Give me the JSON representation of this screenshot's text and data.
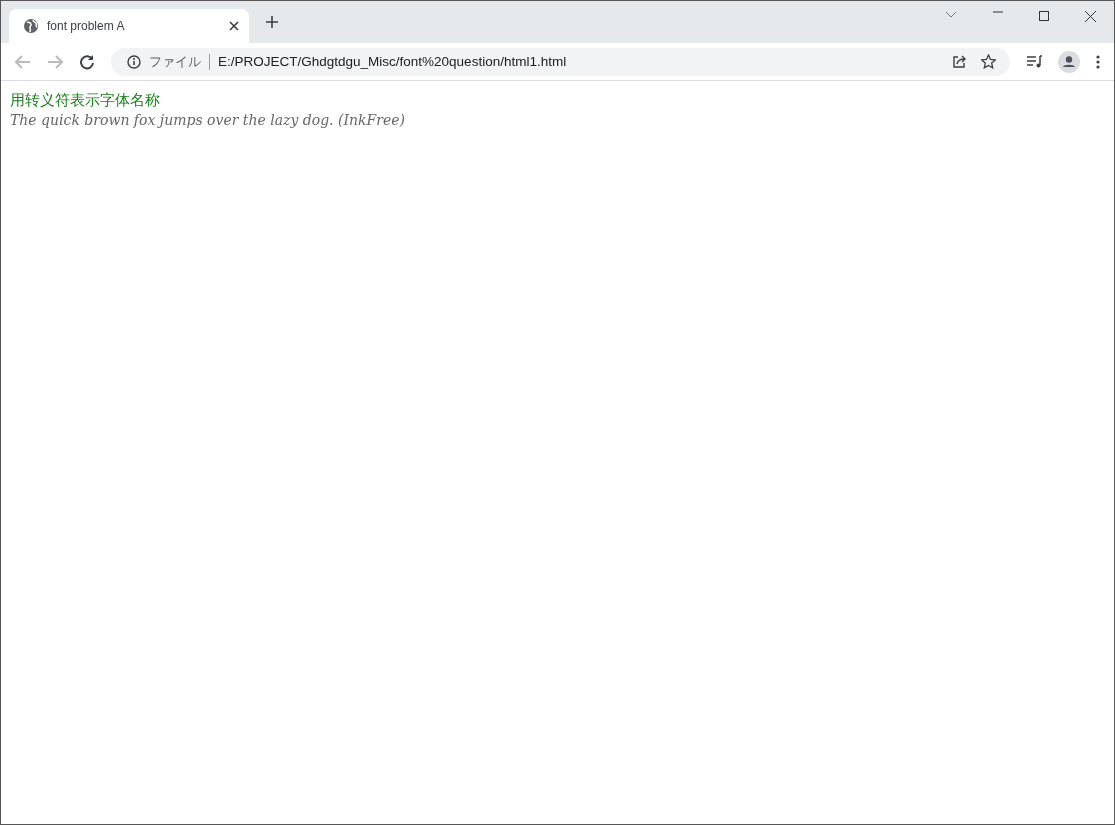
{
  "tabs": [
    {
      "title": "font problem A",
      "selected": true
    }
  ],
  "address_bar": {
    "scheme_label": "ファイル",
    "url": "E:/PROJECT/Ghdgtdgu_Misc/font%20question/html1.html"
  },
  "page": {
    "lines": [
      {
        "kind": "heading",
        "text": "用转义符表示字体名称"
      },
      {
        "kind": "sample",
        "text": "The quick brown fox jumps over the lazy dog. (InkFree)"
      }
    ]
  }
}
